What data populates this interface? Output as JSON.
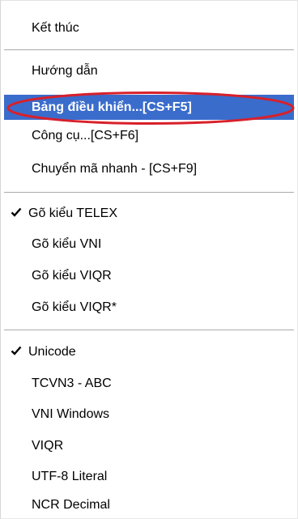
{
  "menu": {
    "items": [
      {
        "label": "Kết thúc"
      },
      {
        "label": "Hướng dẫn"
      },
      {
        "label": "Bảng điều khiển...[CS+F5]"
      },
      {
        "label": "Công cụ...[CS+F6]"
      },
      {
        "label": "Chuyển mã nhanh - [CS+F9]"
      },
      {
        "label": "Gõ kiểu TELEX",
        "checked": true
      },
      {
        "label": "Gõ kiểu VNI"
      },
      {
        "label": "Gõ kiểu VIQR"
      },
      {
        "label": "Gõ kiểu VIQR*"
      },
      {
        "label": "Unicode",
        "checked": true
      },
      {
        "label": "TCVN3 - ABC"
      },
      {
        "label": "VNI Windows"
      },
      {
        "label": "VIQR"
      },
      {
        "label": "UTF-8 Literal"
      },
      {
        "label": "NCR Decimal"
      }
    ],
    "selected_index": 2
  },
  "colors": {
    "selection_bg": "#3a6ccc",
    "annotation_ring": "#d8202a",
    "separator": "#a9a9a9"
  },
  "icons": {
    "check": "checkmark-icon"
  }
}
